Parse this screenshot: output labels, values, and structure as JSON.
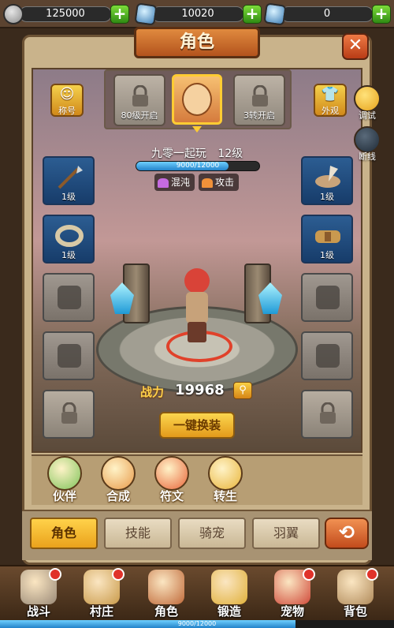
{
  "currency": [
    {
      "icon": "silver-coin-icon",
      "value": "125000"
    },
    {
      "icon": "blue-diamond-icon",
      "value": "10020"
    },
    {
      "icon": "blue-crystal-icon",
      "value": "0"
    }
  ],
  "window": {
    "title": "角色",
    "close_label": "✕"
  },
  "header_slots": {
    "left_lock_caption": "80级开启",
    "right_lock_caption": "3转开启"
  },
  "side_buttons": {
    "title_label": "称号",
    "appearance_label": "外观",
    "debug_label": "调试",
    "disconnect_label": "断线"
  },
  "player": {
    "name": "九零一起玩",
    "level": "12级",
    "xp_text": "9000/12000",
    "xp_fraction": 0.75,
    "tags": [
      {
        "label": "混沌",
        "color": "#c56be0"
      },
      {
        "label": "攻击",
        "color": "#f0913a"
      }
    ]
  },
  "equipment_left": [
    {
      "type": "spear",
      "level": "1级"
    },
    {
      "type": "bracelet",
      "level": "1级"
    },
    {
      "type": "empty",
      "level": ""
    },
    {
      "type": "empty",
      "level": ""
    },
    {
      "type": "locked",
      "level": ""
    }
  ],
  "equipment_right": [
    {
      "type": "helmet",
      "level": "1级"
    },
    {
      "type": "belt",
      "level": "1级"
    },
    {
      "type": "empty",
      "level": ""
    },
    {
      "type": "empty",
      "level": ""
    },
    {
      "type": "locked",
      "level": ""
    }
  ],
  "power": {
    "label": "战力",
    "value": "19968"
  },
  "swap_all_label": "一键换装",
  "features": [
    {
      "label": "伙伴",
      "color": "#7fc35a"
    },
    {
      "label": "合成",
      "color": "#e89a4a"
    },
    {
      "label": "符文",
      "color": "#e9653a"
    },
    {
      "label": "转生",
      "color": "#e8b43a"
    }
  ],
  "tabs": [
    {
      "label": "角色",
      "active": true
    },
    {
      "label": "技能",
      "active": false
    },
    {
      "label": "骑宠",
      "active": false
    },
    {
      "label": "羽翼",
      "active": false
    }
  ],
  "bottom_nav": [
    {
      "label": "战斗",
      "color": "#9a8a78",
      "badge": true
    },
    {
      "label": "村庄",
      "color": "#c99a4a",
      "badge": true
    },
    {
      "label": "角色",
      "color": "#c06a3a",
      "badge": false
    },
    {
      "label": "锻造",
      "color": "#e0b03a",
      "badge": false
    },
    {
      "label": "宠物",
      "color": "#d04a3a",
      "badge": true
    },
    {
      "label": "背包",
      "color": "#b08a5a",
      "badge": true
    }
  ],
  "bottom_xp": {
    "text": "9000/12000",
    "fraction": 0.75
  }
}
